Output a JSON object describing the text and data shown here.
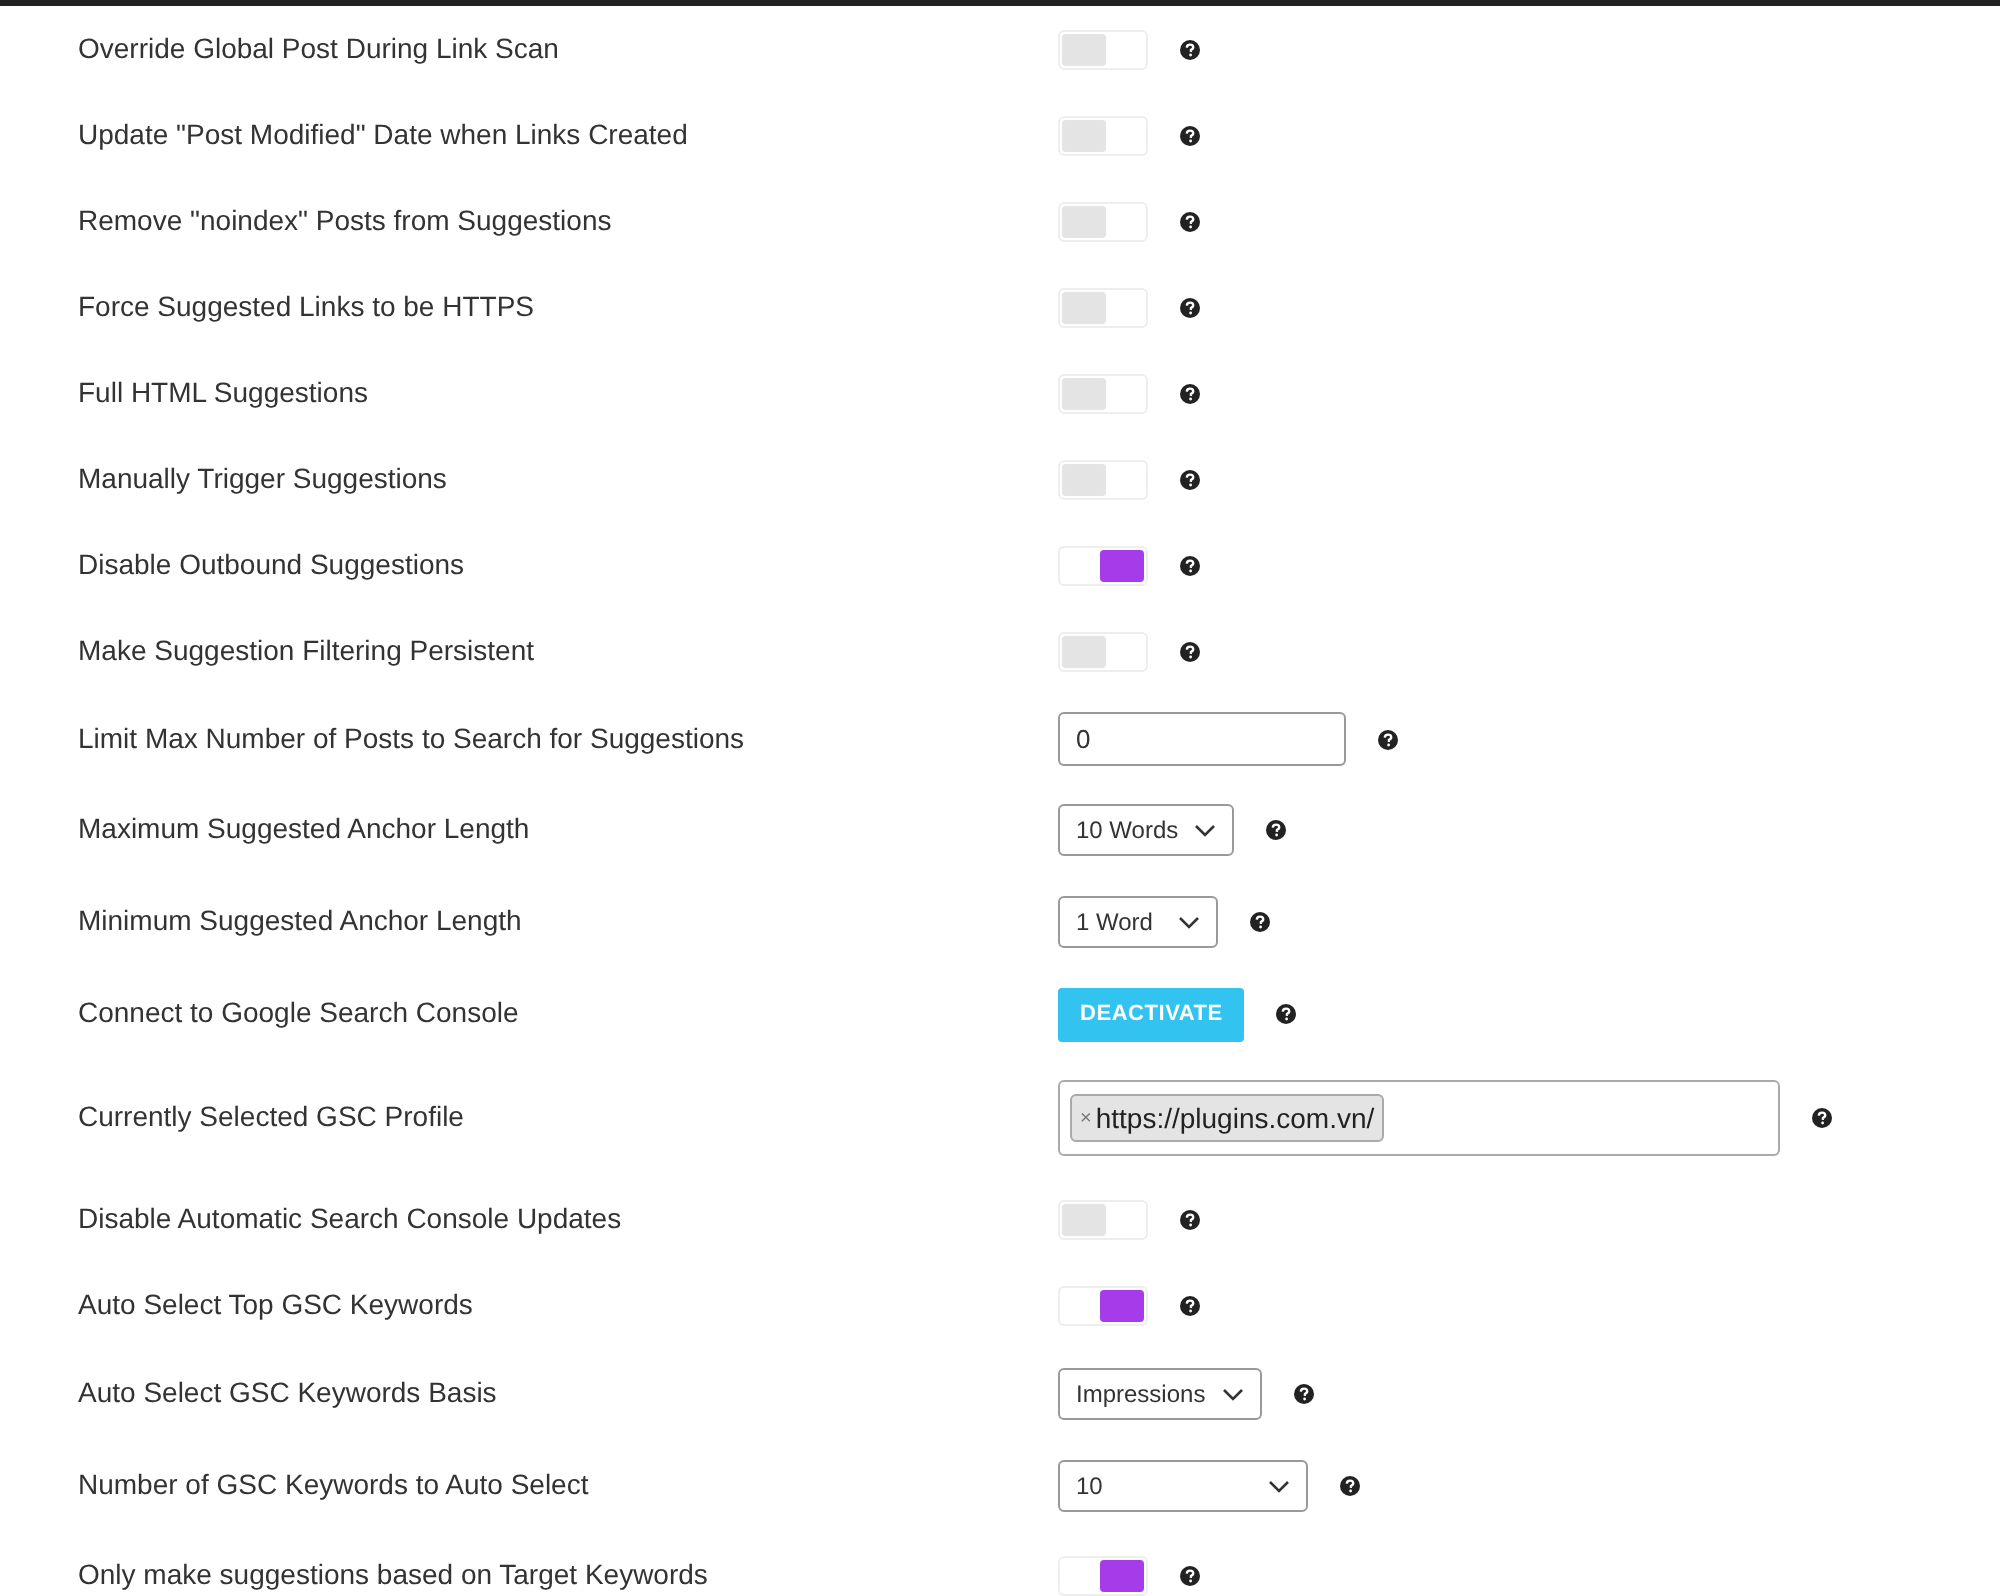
{
  "settings": [
    {
      "label": "Override Global Post During Link Scan",
      "kind": "toggle",
      "on": false
    },
    {
      "label": "Update \"Post Modified\" Date when Links Created",
      "kind": "toggle",
      "on": false
    },
    {
      "label": "Remove \"noindex\" Posts from Suggestions",
      "kind": "toggle",
      "on": false
    },
    {
      "label": "Force Suggested Links to be HTTPS",
      "kind": "toggle",
      "on": false
    },
    {
      "label": "Full HTML Suggestions",
      "kind": "toggle",
      "on": false
    },
    {
      "label": "Manually Trigger Suggestions",
      "kind": "toggle",
      "on": false
    },
    {
      "label": "Disable Outbound Suggestions",
      "kind": "toggle",
      "on": true
    },
    {
      "label": "Make Suggestion Filtering Persistent",
      "kind": "toggle",
      "on": false
    },
    {
      "label": "Limit Max Number of Posts to Search for Suggestions",
      "kind": "input",
      "value": "0"
    },
    {
      "label": "Maximum Suggested Anchor Length",
      "kind": "select",
      "value": "10 Words"
    },
    {
      "label": "Minimum Suggested Anchor Length",
      "kind": "select",
      "value": "1 Word"
    },
    {
      "label": "Connect to Google Search Console",
      "kind": "button",
      "button": "DEACTIVATE"
    },
    {
      "label": "Currently Selected GSC Profile",
      "kind": "tags",
      "tags": [
        {
          "remove": "×",
          "text": "https://plugins.com.vn/"
        }
      ]
    },
    {
      "label": "Disable Automatic Search Console Updates",
      "kind": "toggle",
      "on": false
    },
    {
      "label": "Auto Select Top GSC Keywords",
      "kind": "toggle",
      "on": true
    },
    {
      "label": "Auto Select GSC Keywords Basis",
      "kind": "select",
      "value": "Impressions"
    },
    {
      "label": "Number of GSC Keywords to Auto Select",
      "kind": "select",
      "value": "10",
      "wide": true
    },
    {
      "label": "Only make suggestions based on Target Keywords",
      "kind": "toggle",
      "on": true
    }
  ]
}
